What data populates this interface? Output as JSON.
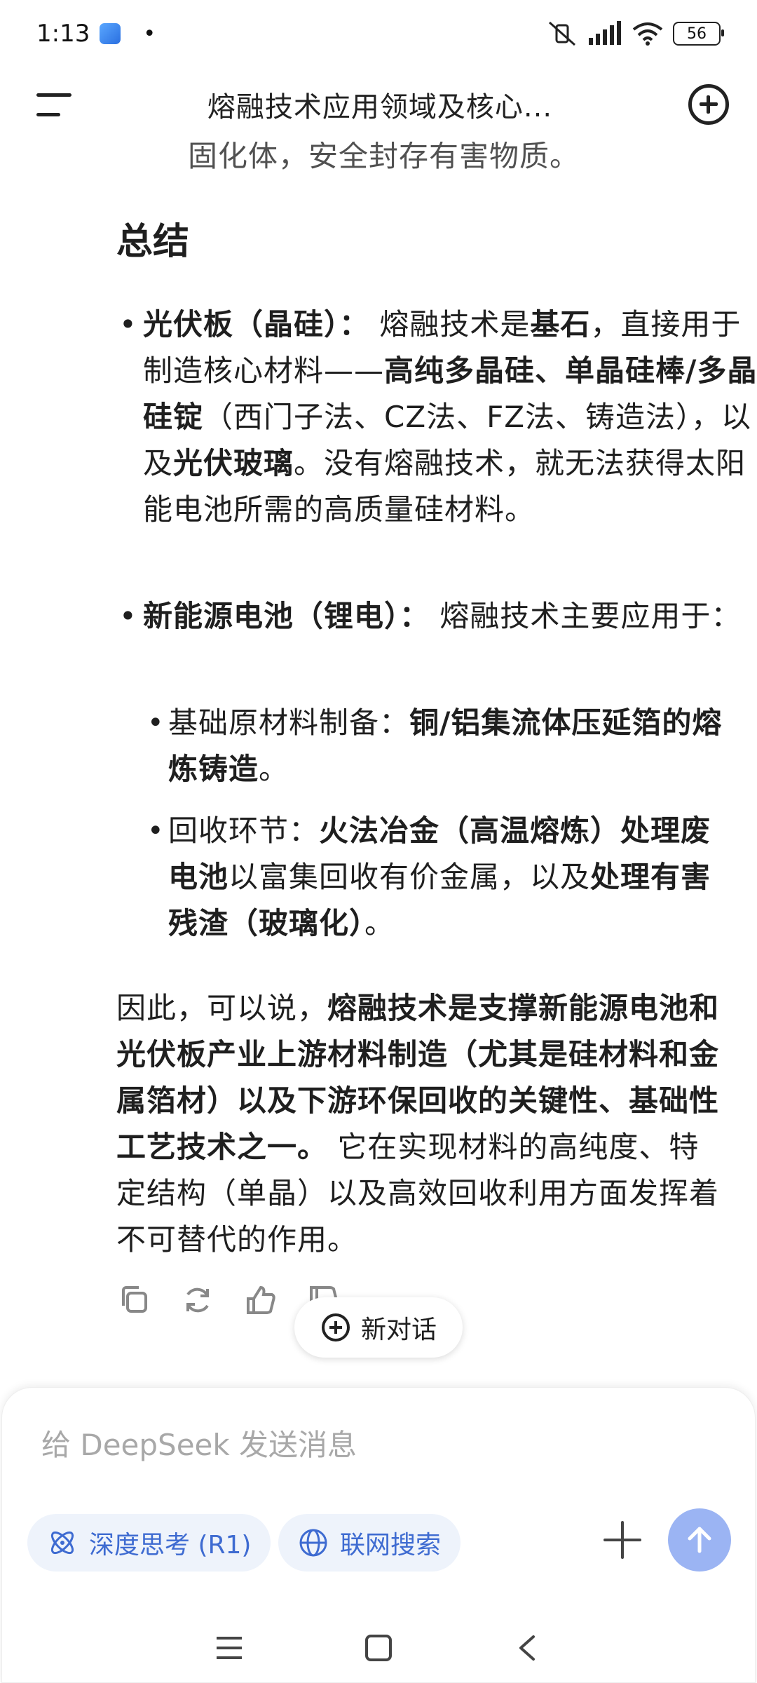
{
  "status": {
    "time": "1:13",
    "battery": "56"
  },
  "header": {
    "title": "熔融技术应用领域及核心..."
  },
  "content": {
    "cut_line": "固化体，安全封存有害物质。",
    "summary_heading": "总结",
    "pv": {
      "label": "光伏板（晶硅）：",
      "t1": " 熔融技术是",
      "b1": "基石",
      "t2": "，直接用于制造核心材料——",
      "b2": "高纯多晶硅、单晶硅棒/多晶硅锭",
      "t3": "（西门子法、CZ法、FZ法、铸造法），以及",
      "b3": "光伏玻璃",
      "t4": "。没有熔融技术，就无法获得太阳能电池所需的高质量硅材料。"
    },
    "battery": {
      "label": "新能源电池（锂电）：",
      "t1": " 熔融技术主要应用于：",
      "sub1_t": "基础原材料制备：",
      "sub1_b": "铜/铝集流体压延箔的熔炼铸造",
      "sub1_end": "。",
      "sub2_t": "回收环节：",
      "sub2_b1": "火法冶金（高温熔炼）处理废电池",
      "sub2_t2": "以富集回收有价金属，以及",
      "sub2_b2": "处理有害残渣（玻璃化）",
      "sub2_end": "。"
    },
    "conclusion": {
      "t1": "因此，可以说，",
      "b1": "熔融技术是支撑新能源电池和光伏板产业上游材料制造（尤其是硅材料和金属箔材）以及下游环保回收的关键性、基础性工艺技术之一。",
      "t2": " 它在实现材料的高纯度、特定结构（单晶）以及高效回收利用方面发挥着不可替代的作用。"
    }
  },
  "actions": {
    "new_chat": "新对话"
  },
  "composer": {
    "placeholder": "给 DeepSeek 发送消息",
    "deep_think": "深度思考 (R1)",
    "web_search": "联网搜索"
  },
  "colors": {
    "accent": "#3e6bd1",
    "send": "#9bb4f3",
    "pill_bg": "#eef3fb"
  }
}
